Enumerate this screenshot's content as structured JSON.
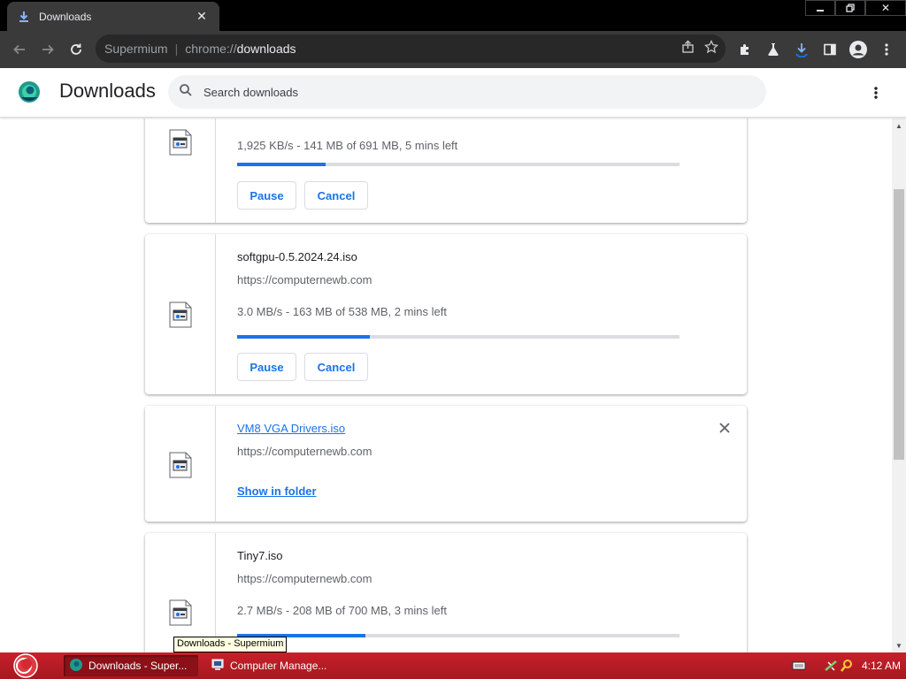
{
  "browser": {
    "tab_title": "Downloads",
    "omnibox_brand": "Supermium",
    "omnibox_url_scheme": "chrome://",
    "omnibox_url_host": "downloads"
  },
  "page": {
    "title": "Downloads",
    "search_placeholder": "Search downloads"
  },
  "downloads": [
    {
      "status": "1,925 KB/s - 141 MB of 691 MB, 5 mins left",
      "progress": 0.2,
      "pause_label": "Pause",
      "cancel_label": "Cancel"
    },
    {
      "name": "softgpu-0.5.2024.24.iso",
      "url": "https://computernewb.com",
      "status": "3.0 MB/s - 163 MB of 538 MB, 2 mins left",
      "progress": 0.3,
      "pause_label": "Pause",
      "cancel_label": "Cancel"
    },
    {
      "name": "VM8 VGA Drivers.iso",
      "url": "https://computernewb.com",
      "show_in_folder_label": "Show in folder"
    },
    {
      "name": "Tiny7.iso",
      "url": "https://computernewb.com",
      "status": "2.7 MB/s - 208 MB of 700 MB, 3 mins left",
      "progress": 0.29
    }
  ],
  "tooltip": "Downloads - Supermium",
  "taskbar": {
    "items": [
      {
        "label": "Downloads - Super..."
      },
      {
        "label": "Computer Manage..."
      }
    ],
    "clock": "4:12 AM"
  },
  "colors": {
    "accent": "#1a73e8",
    "taskbar": "#b81c24",
    "toolbar": "#3a3a3a"
  }
}
